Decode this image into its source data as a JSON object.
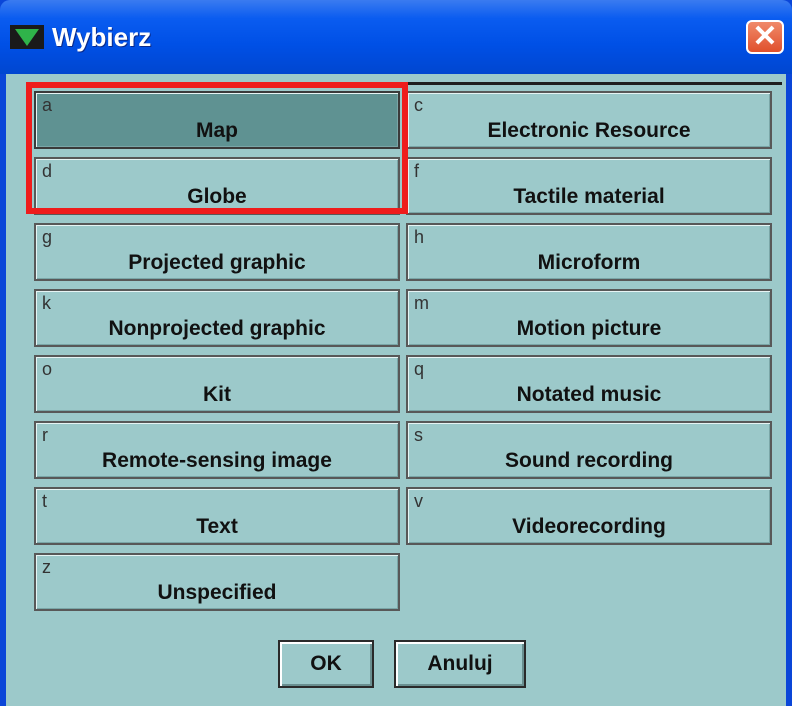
{
  "window": {
    "title": "Wybierz",
    "close_glyph": "✕"
  },
  "icons": {
    "app": "app-triangle-icon",
    "close": "close-icon"
  },
  "items": [
    {
      "code": "a",
      "label": "Map"
    },
    {
      "code": "c",
      "label": "Electronic Resource"
    },
    {
      "code": "d",
      "label": "Globe"
    },
    {
      "code": "f",
      "label": "Tactile material"
    },
    {
      "code": "g",
      "label": "Projected graphic"
    },
    {
      "code": "h",
      "label": "Microform"
    },
    {
      "code": "k",
      "label": "Nonprojected graphic"
    },
    {
      "code": "m",
      "label": "Motion picture"
    },
    {
      "code": "o",
      "label": "Kit"
    },
    {
      "code": "q",
      "label": "Notated music"
    },
    {
      "code": "r",
      "label": "Remote-sensing image"
    },
    {
      "code": "s",
      "label": "Sound recording"
    },
    {
      "code": "t",
      "label": "Text"
    },
    {
      "code": "v",
      "label": "Videorecording"
    },
    {
      "code": "z",
      "label": "Unspecified"
    }
  ],
  "selected_code": "a",
  "buttons": {
    "ok": "OK",
    "cancel": "Anuluj"
  },
  "colors": {
    "titlebar": "#0050e6",
    "panel": "#9cc9ca",
    "selected": "#5f9292",
    "highlight": "#ee1c1c",
    "close": "#e0502c"
  }
}
